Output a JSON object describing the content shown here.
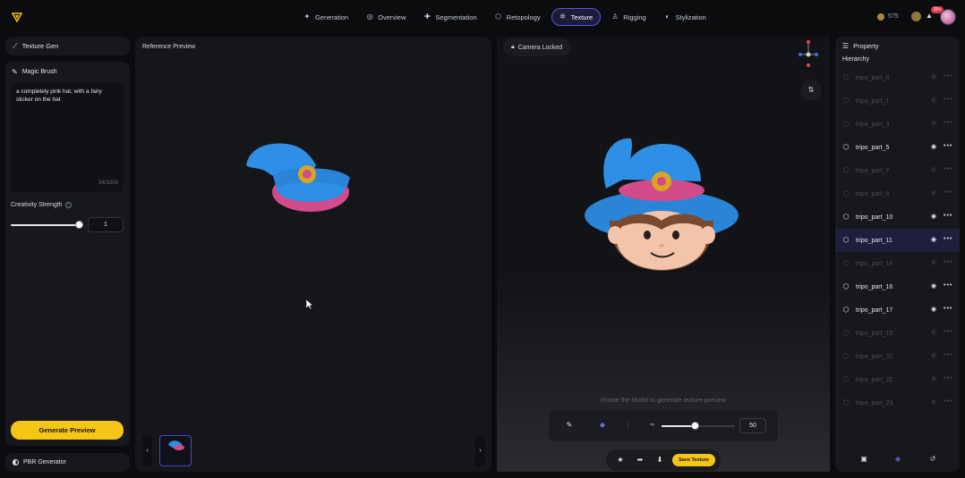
{
  "nav": {
    "items": [
      {
        "label": "Generation",
        "icon": "sparkle-icon",
        "active": false
      },
      {
        "label": "Overview",
        "icon": "overview-icon",
        "active": false
      },
      {
        "label": "Segmentation",
        "icon": "puzzle-icon",
        "active": false
      },
      {
        "label": "Retopology",
        "icon": "mesh-icon",
        "active": false
      },
      {
        "label": "Texture",
        "icon": "texture-icon",
        "active": true
      },
      {
        "label": "Rigging",
        "icon": "figure-icon",
        "active": false
      },
      {
        "label": "Stylization",
        "icon": "palette-icon",
        "active": false
      }
    ]
  },
  "account": {
    "credits": "575",
    "notifications": "99+"
  },
  "left": {
    "header": "Texture Gen",
    "magic_brush": "Magic Brush",
    "prompt": "a completely pink hat, with a fairy sticker on the hat",
    "counter": "54/1000",
    "creativity_label": "Creativity Strength",
    "creativity_value": "1",
    "generate_label": "Generate Preview",
    "pbr_label": "PBR Generator"
  },
  "reference": {
    "title": "Reference Preview"
  },
  "viewport": {
    "camera_label": "Camera Locked",
    "hint": "Rotate the Model to generate texture preview",
    "brush_size": "50",
    "save_label": "Save Texture"
  },
  "property": {
    "title": "Property",
    "hierarchy": "Hierarchy",
    "parts": [
      {
        "name": "tripo_part_0",
        "visible": false,
        "selected": false
      },
      {
        "name": "tripo_part_1",
        "visible": false,
        "selected": false
      },
      {
        "name": "tripo_part_3",
        "visible": false,
        "selected": false
      },
      {
        "name": "tripo_part_5",
        "visible": true,
        "selected": false
      },
      {
        "name": "tripo_part_7",
        "visible": false,
        "selected": false
      },
      {
        "name": "tripo_part_8",
        "visible": false,
        "selected": false
      },
      {
        "name": "tripo_part_10",
        "visible": true,
        "selected": false
      },
      {
        "name": "tripo_part_11",
        "visible": true,
        "selected": true
      },
      {
        "name": "tripo_part_14",
        "visible": false,
        "selected": false
      },
      {
        "name": "tripo_part_16",
        "visible": true,
        "selected": false
      },
      {
        "name": "tripo_part_17",
        "visible": true,
        "selected": false
      },
      {
        "name": "tripo_part_19",
        "visible": false,
        "selected": false
      },
      {
        "name": "tripo_part_20",
        "visible": false,
        "selected": false
      },
      {
        "name": "tripo_part_22",
        "visible": false,
        "selected": false
      },
      {
        "name": "tripo_part_23",
        "visible": false,
        "selected": false
      }
    ]
  },
  "colors": {
    "accent": "#f5c518",
    "active": "#5a55e0",
    "hat_blue": "#2e8fe6",
    "hat_band": "#d14b8a"
  }
}
